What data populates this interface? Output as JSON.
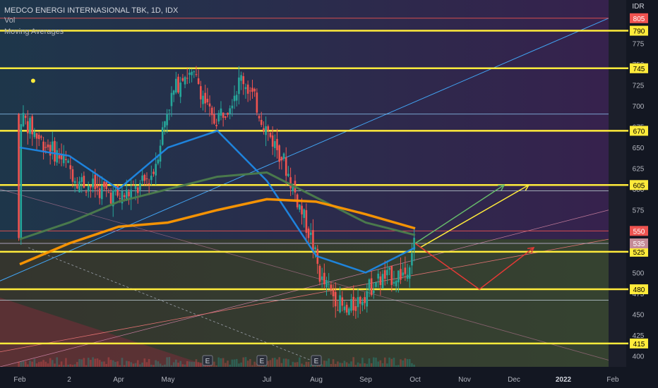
{
  "header": {
    "title": "MEDCO ENERGI INTERNASIONAL TBK, 1D, IDX",
    "indicator_volume": "Vol",
    "indicator_moving_averages": "Moving Averages"
  },
  "colors": {
    "background": "#131722",
    "up": "#26a69a",
    "down": "#ef5350",
    "level_line": "#ffeb3b",
    "ma_fast": "#1e88e5",
    "ma_mid": "#4c7d4c",
    "ma_slow": "#ff9800",
    "proj_up_green": "#66bb6a",
    "proj_up_yellow": "#ffeb3b",
    "proj_down_red": "#e53935"
  },
  "chart_data": {
    "type": "candlestick",
    "title": "MEDCO ENERGI INTERNASIONAL TBK, 1D, IDX",
    "currency_label": "IDX",
    "axis_currency": "IDR",
    "x_ticks": [
      "Feb",
      "2",
      "Apr",
      "May",
      "Jul",
      "Aug",
      "Sep",
      "Oct",
      "Nov",
      "Dec",
      "2022",
      "Feb"
    ],
    "x_tick_positions_by_month_index": [
      1,
      2,
      3,
      4,
      6,
      7,
      8,
      9,
      10,
      11,
      12,
      13
    ],
    "y_ticks": [
      400,
      425,
      450,
      475,
      500,
      525,
      550,
      575,
      600,
      625,
      650,
      675,
      700,
      725,
      750,
      775,
      790,
      805
    ],
    "ylim": [
      387,
      815
    ],
    "price_tags_yellow": [
      790,
      745,
      670,
      605,
      525,
      480,
      415
    ],
    "price_tags_red": [
      805,
      550
    ],
    "price_tag_last": 535,
    "earnings_markers": [
      "E",
      "E",
      "E"
    ],
    "earnings_month_index": [
      4.8,
      5.9,
      7.0
    ],
    "grid": false,
    "legend": "none",
    "candles_approx_close_by_month": {
      "Feb": 690,
      "Mar": 650,
      "Apr": 590,
      "May": 740,
      "Jun": 680,
      "Jul": 590,
      "Aug": 480,
      "Sep": 500,
      "Oct": 550
    },
    "moving_averages": [
      {
        "name": "MA fast",
        "values_by_month": [
          650,
          640,
          600,
          650,
          670,
          610,
          520,
          500,
          530
        ]
      },
      {
        "name": "MA mid",
        "values_by_month": [
          540,
          560,
          585,
          600,
          615,
          620,
          590,
          560,
          545
        ]
      },
      {
        "name": "MA slow",
        "values_by_month": [
          510,
          535,
          555,
          560,
          575,
          588,
          585,
          570,
          553
        ]
      }
    ],
    "projection_paths": [
      {
        "color": "green",
        "points": [
          [
            9.0,
            535
          ],
          [
            10.8,
            605
          ]
        ]
      },
      {
        "color": "yellow",
        "points": [
          [
            9.1,
            530
          ],
          [
            11.3,
            605
          ]
        ]
      },
      {
        "color": "red",
        "points": [
          [
            9.0,
            535
          ],
          [
            10.3,
            480
          ],
          [
            11.4,
            530
          ]
        ]
      }
    ]
  }
}
